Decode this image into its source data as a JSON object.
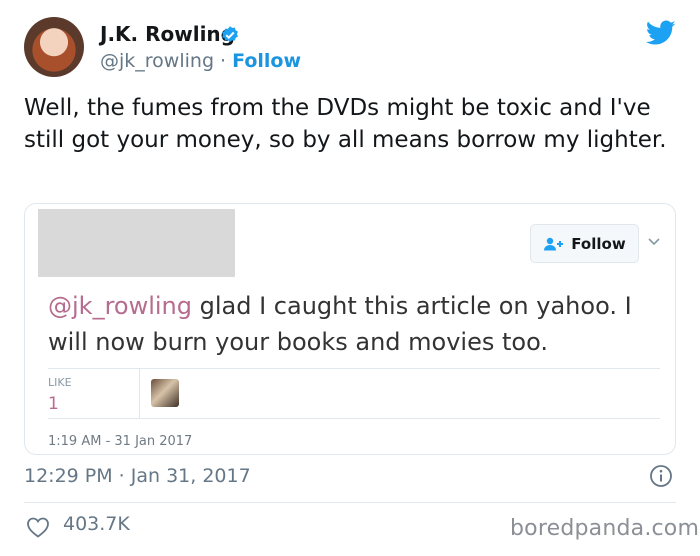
{
  "author": {
    "name": "J.K. Rowling",
    "handle": "@jk_rowling",
    "separator": " · ",
    "follow_label": "Follow"
  },
  "tweet": {
    "text": "Well, the fumes from the DVDs might be toxic and I've still got your money, so by all means borrow my lighter.",
    "timestamp": "12:29 PM · Jan 31, 2017",
    "like_count": "403.7K"
  },
  "quoted_tweet": {
    "follow_label": "Follow",
    "mention": "@jk_rowling",
    "text": " glad I caught this article on yahoo. I will now burn your books and movies too.",
    "like_label": "LIKE",
    "like_count": "1",
    "date": "1:19 AM - 31 Jan 2017"
  },
  "watermark": "boredpanda.com",
  "icons": {
    "verified": "verified-badge-icon",
    "brand": "twitter-bird-icon",
    "info": "info-icon",
    "like": "heart-icon",
    "add_user": "add-user-icon",
    "menu": "chevron-down-icon"
  },
  "colors": {
    "brand": "#1da1f2",
    "follow_link": "#1b95e0",
    "secondary_text": "#657786",
    "mention": "#b56c8f"
  }
}
